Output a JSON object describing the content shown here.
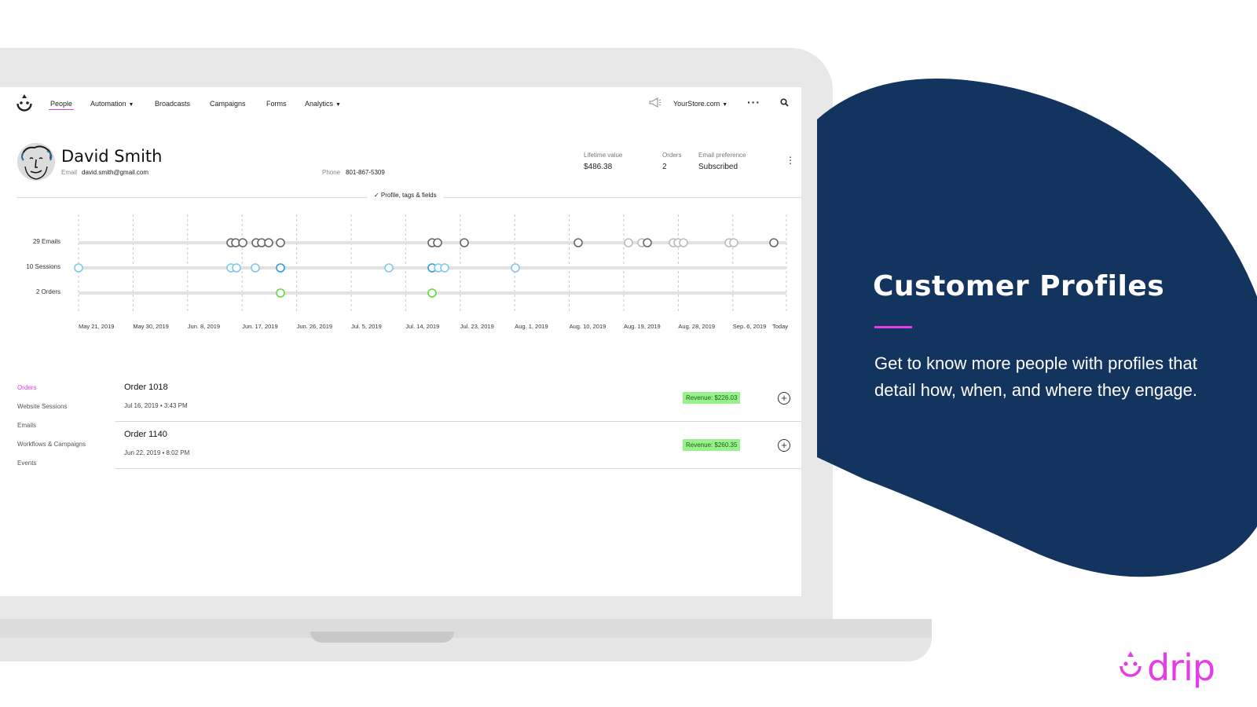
{
  "nav": {
    "items": [
      {
        "label": "People",
        "active": true
      },
      {
        "label": "Automation",
        "dropdown": true
      },
      {
        "label": "Broadcasts"
      },
      {
        "label": "Campaigns"
      },
      {
        "label": "Forms"
      },
      {
        "label": "Analytics",
        "dropdown": true
      }
    ],
    "store": "YourStore.com",
    "more_icon": "more-icon",
    "search_icon": "search-icon",
    "announce_icon": "megaphone-icon"
  },
  "profile": {
    "name": "David Smith",
    "email_label": "Email",
    "email": "david.smith@gmail.com",
    "phone_label": "Phone",
    "phone": "801-867-5309",
    "stats": [
      {
        "label": "Lifetime value",
        "value": "$486.38"
      },
      {
        "label": "Orders",
        "value": "2"
      },
      {
        "label": "Email preference",
        "value": "Subscribed"
      }
    ],
    "edit_link": "✓ Profile, tags & fields"
  },
  "timeline": {
    "rows": [
      {
        "label": "29 Emails",
        "color": "#666666"
      },
      {
        "label": "10 Sessions",
        "color": "#7cc8ee"
      },
      {
        "label": "2 Orders",
        "color": "#5ddd3a"
      }
    ],
    "dates": [
      "May 21, 2019",
      "May 30, 2019",
      "Jun. 8, 2019",
      "Jun. 17, 2019",
      "Jun. 26, 2019",
      "Jul. 5, 2019",
      "Jul. 14, 2019",
      "Jul. 23, 2019",
      "Aug. 1, 2019",
      "Aug. 10, 2019",
      "Aug. 19, 2019",
      "Aug. 28, 2019",
      "Sep. 6, 2019",
      "Today"
    ]
  },
  "tabs": [
    {
      "label": "Orders",
      "active": true
    },
    {
      "label": "Website Sessions"
    },
    {
      "label": "Emails"
    },
    {
      "label": "Workflows & Campaigns"
    },
    {
      "label": "Events"
    }
  ],
  "orders": [
    {
      "title": "Order 1018",
      "date": "Jul 16, 2019 • 3:43 PM",
      "revenue": "Revenue: $226.03"
    },
    {
      "title": "Order 1140",
      "date": "Jun 22, 2019 • 8:02 PM",
      "revenue": "Revenue: $260.35"
    }
  ],
  "hero": {
    "title": "Customer Profiles",
    "body": "Get to know more people with profiles that detail how, when, and where they engage.",
    "blob_color": "#12345e",
    "accent": "#e63ce8"
  },
  "brand": {
    "logo_word": "drip",
    "color": "#e63ce8"
  }
}
